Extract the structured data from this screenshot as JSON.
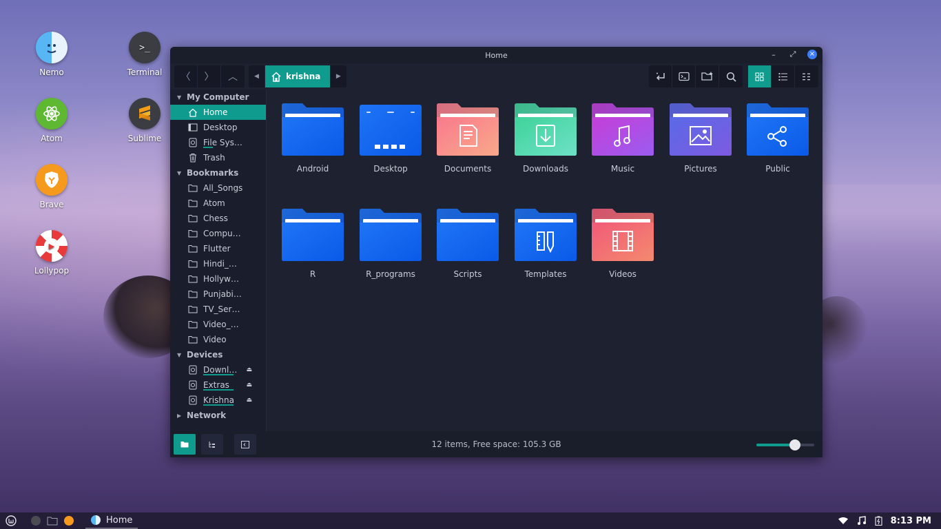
{
  "desktop": {
    "icons": [
      {
        "label": "Nemo",
        "name": "nemo-icon"
      },
      {
        "label": "Terminal",
        "name": "terminal-icon"
      },
      {
        "label": "Atom",
        "name": "atom-icon"
      },
      {
        "label": "Sublime",
        "name": "sublime-icon"
      },
      {
        "label": "Brave",
        "name": "brave-icon"
      },
      {
        "label": "Lollypop",
        "name": "lollypop-icon"
      }
    ]
  },
  "window": {
    "title": "Home",
    "minimize_glyph": "–",
    "maximize_glyph": "⤢",
    "close_glyph": "×"
  },
  "toolbar": {
    "crumb_label": "krishna",
    "back_glyph": "〈",
    "forward_glyph": "〉",
    "up_glyph": "︿",
    "crumb_left_glyph": "◀",
    "crumb_right_glyph": "▶"
  },
  "sidebar": {
    "sections": {
      "computer": "My Computer",
      "bookmarks": "Bookmarks",
      "devices": "Devices",
      "network": "Network"
    },
    "computer_items": [
      "Home",
      "Desktop",
      "File Sys…",
      "Trash"
    ],
    "bookmark_items": [
      "All_Songs",
      "Atom",
      "Chess",
      "Compu…",
      "Flutter",
      "Hindi_…",
      "Hollyw…",
      "Punjabi…",
      "TV_Ser…",
      "Video_…",
      "Video"
    ],
    "device_items": [
      "Downl…",
      "Extras",
      "Krishna"
    ],
    "eject_glyph": "⏏"
  },
  "folders": [
    {
      "label": "Android",
      "icon": "android-folder-icon",
      "color_top": "#1e74f5",
      "color_bottom": "#0a5ae8"
    },
    {
      "label": "Desktop",
      "icon": "desktop-folder-icon",
      "color_top": "#1e74f5",
      "color_bottom": "#0a5ae8"
    },
    {
      "label": "Documents",
      "icon": "documents-folder-icon",
      "color_top": "#f97a8d",
      "color_bottom": "#f9a98a"
    },
    {
      "label": "Downloads",
      "icon": "downloads-folder-icon",
      "color_top": "#3fd39a",
      "color_bottom": "#6ee1c6"
    },
    {
      "label": "Music",
      "icon": "music-folder-icon",
      "color_top": "#c43fd8",
      "color_bottom": "#9b5cf0"
    },
    {
      "label": "Pictures",
      "icon": "pictures-folder-icon",
      "color_top": "#5a6ae8",
      "color_bottom": "#7d5ae0"
    },
    {
      "label": "Public",
      "icon": "public-folder-icon",
      "color_top": "#1e74f5",
      "color_bottom": "#0a5ae8"
    },
    {
      "label": "R",
      "icon": "r-folder-icon",
      "color_top": "#1e74f5",
      "color_bottom": "#0a5ae8"
    },
    {
      "label": "R_programs",
      "icon": "r-programs-folder-icon",
      "color_top": "#1e74f5",
      "color_bottom": "#0a5ae8"
    },
    {
      "label": "Scripts",
      "icon": "scripts-folder-icon",
      "color_top": "#1e74f5",
      "color_bottom": "#0a5ae8"
    },
    {
      "label": "Templates",
      "icon": "templates-folder-icon",
      "color_top": "#1e74f5",
      "color_bottom": "#0a5ae8"
    },
    {
      "label": "Videos",
      "icon": "videos-folder-icon",
      "color_top": "#f25a78",
      "color_bottom": "#f38a6e"
    }
  ],
  "statusbar": {
    "text": "12 items, Free space: 105.3 GB",
    "zoom_level": 0.67
  },
  "taskbar": {
    "task_label": "Home",
    "clock": "8:13 PM"
  },
  "colors": {
    "accent": "#0f9c8f",
    "window_bg": "#1d2130"
  }
}
